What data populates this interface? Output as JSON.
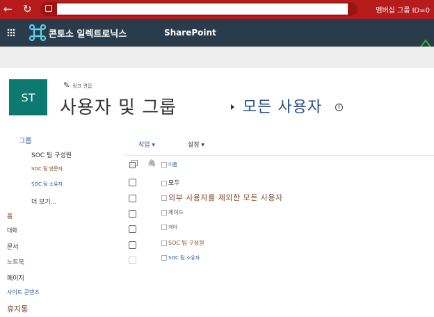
{
  "browser": {
    "right_text": "멤버십 그룹 ID=0"
  },
  "suitebar": {
    "brand": "콘토소 일렉트로닉스",
    "app": "SharePoint"
  },
  "header": {
    "tile": "ST",
    "edit_link": "링크 편집",
    "title": "사용자 및 그룹",
    "subtitle": "모든 사용자",
    "info": "i"
  },
  "nav": {
    "groups_heading": "그룹",
    "items": [
      {
        "label": "SOC 팀 구성원"
      },
      {
        "label": "SOC 팀 방문자"
      },
      {
        "label": "SOC 팀 소유자"
      },
      {
        "label": "더 보기..."
      },
      {
        "label": "홈"
      },
      {
        "label": "대화"
      },
      {
        "label": "문서"
      },
      {
        "label": "노트북"
      },
      {
        "label": "페이지"
      },
      {
        "label": "사이트 콘텐츠"
      },
      {
        "label": "휴지통"
      }
    ]
  },
  "toolbar": {
    "actions": "작업 ▾",
    "settings": "설정 ▾"
  },
  "list": {
    "header_name": "이름",
    "rows": [
      {
        "label": "모두"
      },
      {
        "label": "외부 사용자를 제외한 모든 사용자"
      },
      {
        "label": "제이드"
      },
      {
        "label": "케어"
      },
      {
        "label": "SOC 팀 구성원"
      },
      {
        "label": "SOC 팀 소유자"
      }
    ]
  },
  "colors": {
    "browser_bar": "#b71c1c",
    "suite_bar": "#2a3b4c",
    "tile": "#0d7a72",
    "link_blue": "#2b5797",
    "link_brown": "#7a4a2a",
    "annotation_arrow": "#2db52d"
  }
}
